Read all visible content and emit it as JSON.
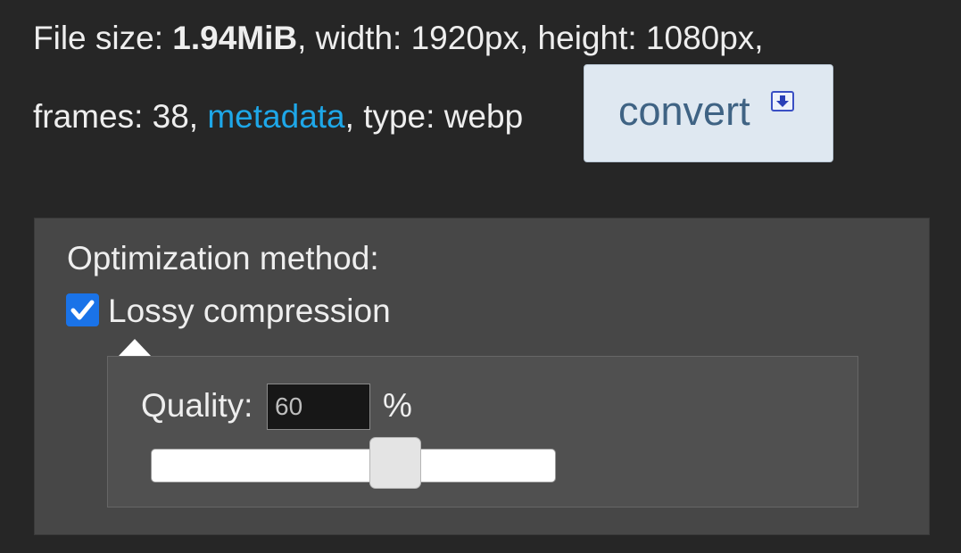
{
  "file_info": {
    "size_label": "File size: ",
    "size_value": "1.94MiB",
    "width_text": ", width: 1920px, height: 1080px,",
    "frames_text": "frames: 38, ",
    "metadata_link": "metadata",
    "type_text": ", type: webp"
  },
  "convert": {
    "label": "convert",
    "icon": "download-arrow-icon"
  },
  "optimization": {
    "title": "Optimization method:",
    "lossy_label": "Lossy compression",
    "lossy_checked": true,
    "quality_label": "Quality:",
    "quality_value": "60",
    "percent_label": "%",
    "slider_value": 60,
    "slider_range": [
      0,
      100
    ]
  },
  "colors": {
    "background": "#262626",
    "panel": "#474747",
    "link": "#1ea7e8",
    "button_bg": "#dfe8f1",
    "button_text": "#3f6384",
    "checkbox": "#1a73e8"
  }
}
